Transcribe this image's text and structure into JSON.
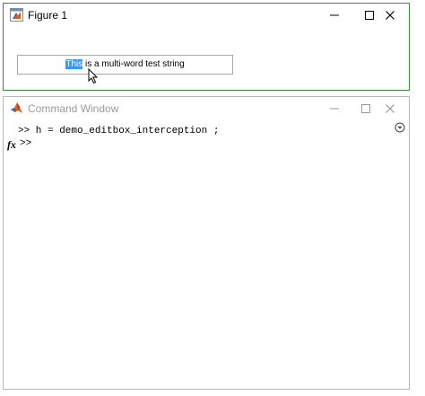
{
  "figure_window": {
    "title": "Figure 1",
    "edit_box": {
      "selected_text": "This",
      "rest_text": " is a multi-word test string"
    }
  },
  "command_window": {
    "title": "Command Window",
    "history_line": ">> h = demo_editbox_interception ;",
    "fx_label": "fx",
    "prompt": ">>"
  }
}
